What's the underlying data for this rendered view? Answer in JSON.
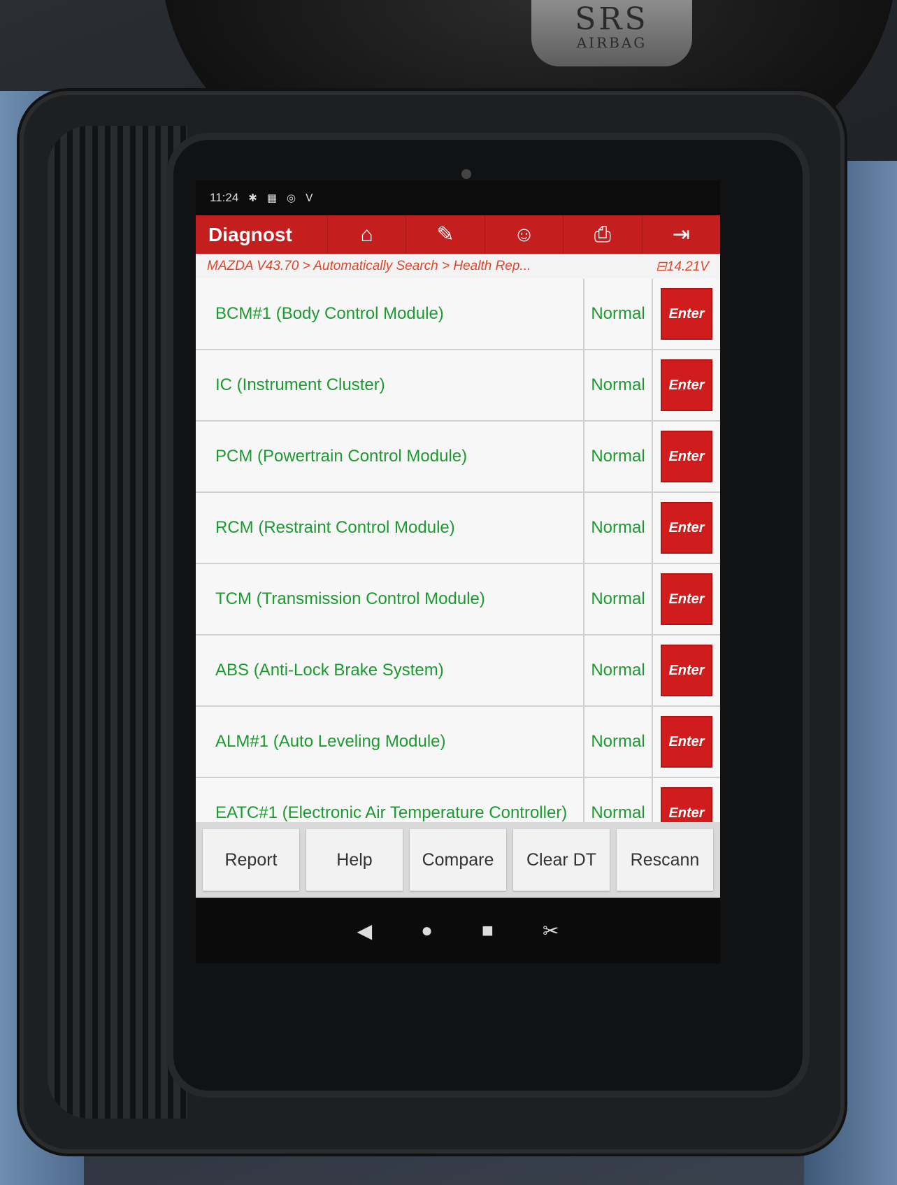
{
  "status_bar": {
    "time": "11:24"
  },
  "header": {
    "title": "Diagnost",
    "buttons": [
      {
        "name": "home",
        "glyph": "⌂"
      },
      {
        "name": "edit",
        "glyph": "✎"
      },
      {
        "name": "user",
        "glyph": "☺"
      },
      {
        "name": "print",
        "glyph": "⎙"
      },
      {
        "name": "exit",
        "glyph": "⇥"
      }
    ]
  },
  "breadcrumb": {
    "path": "MAZDA V43.70 > Automatically Search > Health Rep...",
    "voltage": "14.21V"
  },
  "modules": [
    {
      "name": "BCM#1 (Body Control Module)",
      "status": "Normal",
      "action": "Enter"
    },
    {
      "name": "IC (Instrument Cluster)",
      "status": "Normal",
      "action": "Enter"
    },
    {
      "name": "PCM (Powertrain Control Module)",
      "status": "Normal",
      "action": "Enter"
    },
    {
      "name": "RCM (Restraint Control Module)",
      "status": "Normal",
      "action": "Enter"
    },
    {
      "name": "TCM (Transmission Control Module)",
      "status": "Normal",
      "action": "Enter"
    },
    {
      "name": "ABS (Anti-Lock Brake System)",
      "status": "Normal",
      "action": "Enter"
    },
    {
      "name": "ALM#1 (Auto Leveling Module)",
      "status": "Normal",
      "action": "Enter"
    },
    {
      "name": "EATC#1 (Electronic Air Temperature Controller)",
      "status": "Normal",
      "action": "Enter"
    }
  ],
  "footer_buttons": [
    "Report",
    "Help",
    "Compare",
    "Clear DT",
    "Rescann"
  ],
  "airbag_badge": {
    "line1": "SRS",
    "line2": "AIRBAG"
  },
  "colors": {
    "accent_red": "#c41e1e",
    "status_green": "#1c9a30",
    "breadcrumb_orange": "#e0452a"
  }
}
